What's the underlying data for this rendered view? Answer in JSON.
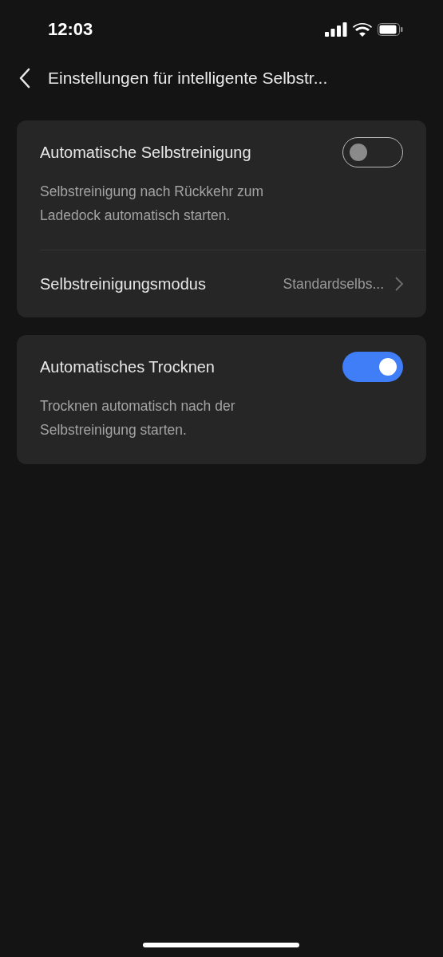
{
  "status_bar": {
    "time": "12:03"
  },
  "header": {
    "title": "Einstellungen für intelligente Selbstr..."
  },
  "cards": [
    {
      "rows": [
        {
          "kind": "toggle",
          "title": "Automatische Selbstreinigung",
          "on": false,
          "description": "Selbstreinigung nach Rückkehr zum Ladedock automatisch starten."
        },
        {
          "kind": "link",
          "title": "Selbstreinigungsmodus",
          "value": "Standardselbs..."
        }
      ]
    },
    {
      "rows": [
        {
          "kind": "toggle",
          "title": "Automatisches Trocknen",
          "on": true,
          "description": "Trocknen automatisch nach der Selbstreinigung starten."
        }
      ]
    }
  ]
}
